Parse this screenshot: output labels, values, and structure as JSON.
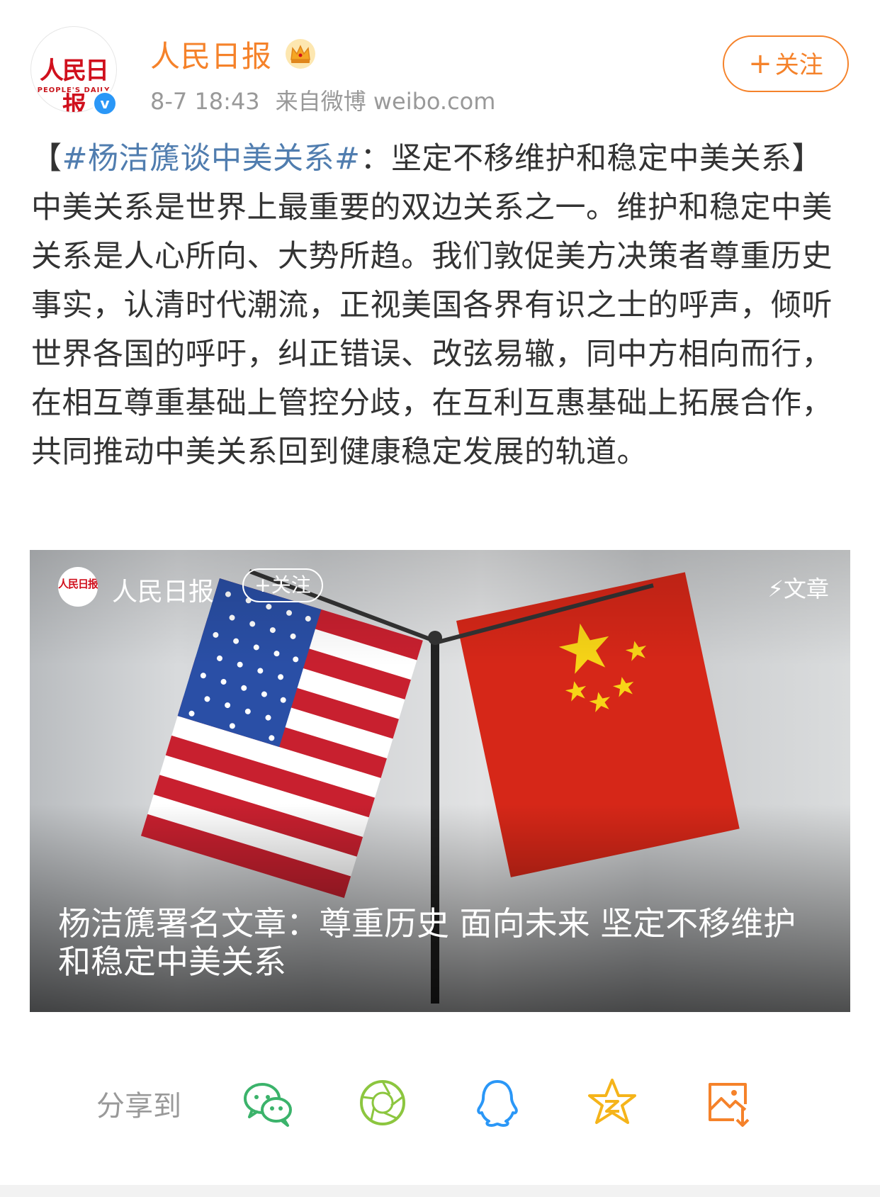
{
  "user": {
    "name": "人民日报",
    "avatar_logo": "人民日报",
    "avatar_sub": "PEOPLE'S DAILY",
    "verified_mark": "v",
    "time": "8-7 18:43",
    "source": "来自微博 weibo.com"
  },
  "follow_button": {
    "plus": "+",
    "label": "关注"
  },
  "post": {
    "open_bracket": "【",
    "hashtag": "#杨洁篪谈中美关系#",
    "text": "：坚定不移维护和稳定中美关系】中美关系是世界上最重要的双边关系之一。维护和稳定中美关系是人心所向、大势所趋。我们敦促美方决策者尊重历史事实，认清时代潮流，正视美国各界有识之士的呼声，倾听世界各国的呼吁，纠正错误、改弦易辙，同中方相向而行，在相互尊重基础上管控分歧，在互利互惠基础上拓展合作，共同推动中美关系回到健康稳定发展的轨道。"
  },
  "article_card": {
    "user": "人民日报",
    "follow": "+关注",
    "type_icon": "lightning-icon",
    "type": "文章",
    "title": "杨洁篪署名文章：尊重历史 面向未来 坚定不移维护和稳定中美关系"
  },
  "share": {
    "label": "分享到",
    "targets": [
      "wechat-icon",
      "moments-icon",
      "qq-icon",
      "qzone-icon",
      "save-image-icon"
    ]
  },
  "colors": {
    "accent": "#f5822a",
    "link": "#507daf",
    "verified": "#2a97f7",
    "wechat": "#3bb36b",
    "moments": "#8cc63f",
    "qq": "#2a97f7",
    "qzone": "#f5b41a",
    "save": "#f5822a"
  }
}
